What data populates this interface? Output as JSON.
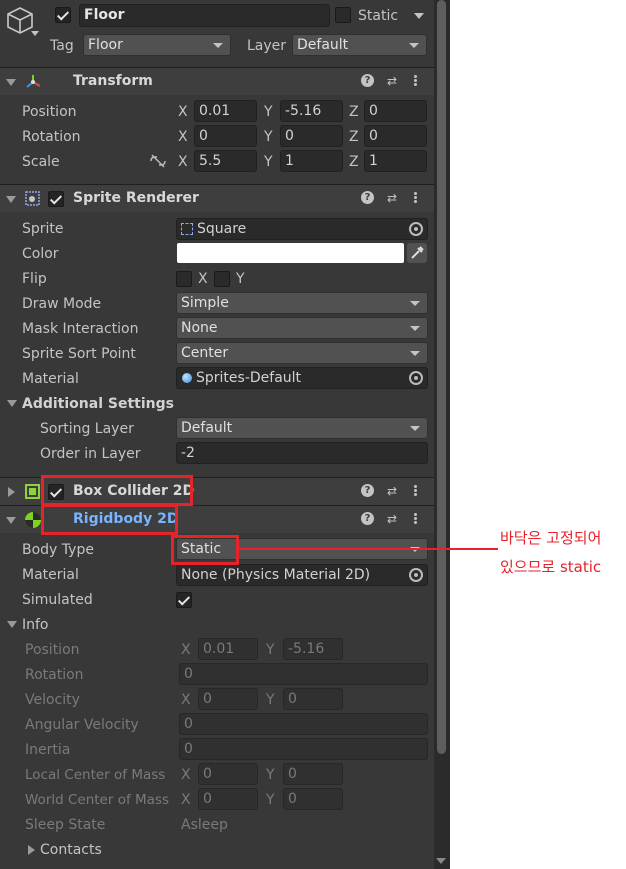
{
  "header": {
    "name": "Floor",
    "static_label": "Static",
    "tag_label": "Tag",
    "tag_value": "Floor",
    "layer_label": "Layer",
    "layer_value": "Default"
  },
  "transform": {
    "title": "Transform",
    "rows": [
      {
        "label": "Position",
        "x": "0.01",
        "y": "-5.16",
        "z": "0"
      },
      {
        "label": "Rotation",
        "x": "0",
        "y": "0",
        "z": "0"
      },
      {
        "label": "Scale",
        "x": "5.5",
        "y": "1",
        "z": "1"
      }
    ],
    "axis": {
      "x": "X",
      "y": "Y",
      "z": "Z"
    }
  },
  "sprite_renderer": {
    "title": "Sprite Renderer",
    "sprite_label": "Sprite",
    "sprite_value": "Square",
    "color_label": "Color",
    "color_value": "#ffffff",
    "flip_label": "Flip",
    "flip_x": "X",
    "flip_y": "Y",
    "draw_mode_label": "Draw Mode",
    "draw_mode_value": "Simple",
    "mask_label": "Mask Interaction",
    "mask_value": "None",
    "sort_point_label": "Sprite Sort Point",
    "sort_point_value": "Center",
    "material_label": "Material",
    "material_value": "Sprites-Default",
    "additional_label": "Additional Settings",
    "sorting_layer_label": "Sorting Layer",
    "sorting_layer_value": "Default",
    "order_label": "Order in Layer",
    "order_value": "-2"
  },
  "box_collider": {
    "title": "Box Collider 2D"
  },
  "rigidbody": {
    "title": "Rigidbody 2D",
    "body_type_label": "Body Type",
    "body_type_value": "Static",
    "material_label": "Material",
    "material_value": "None (Physics Material 2D)",
    "simulated_label": "Simulated",
    "info_label": "Info",
    "position_label": "Position",
    "position_x": "0.01",
    "position_y": "-5.16",
    "rotation_label": "Rotation",
    "rotation_value": "0",
    "velocity_label": "Velocity",
    "velocity_x": "0",
    "velocity_y": "0",
    "ang_vel_label": "Angular Velocity",
    "ang_vel_value": "0",
    "inertia_label": "Inertia",
    "inertia_value": "0",
    "local_com_label": "Local Center of Mass",
    "local_com_x": "0",
    "local_com_y": "0",
    "world_com_label": "World Center of Mass",
    "world_com_x": "0",
    "world_com_y": "0",
    "sleep_label": "Sleep State",
    "sleep_value": "Asleep",
    "contacts_label": "Contacts"
  },
  "annotation": {
    "line1": "바닥은 고정되어",
    "line2": "있으므로 static",
    "color": "#e6222b"
  },
  "icons": [
    "gameobject-cube-icon",
    "transform-icon",
    "sprite-renderer-icon",
    "box-collider-icon",
    "rigidbody-icon",
    "help-icon",
    "preset-icon",
    "menu-icon",
    "unlink-icon",
    "object-picker-icon",
    "eyedropper-icon"
  ]
}
